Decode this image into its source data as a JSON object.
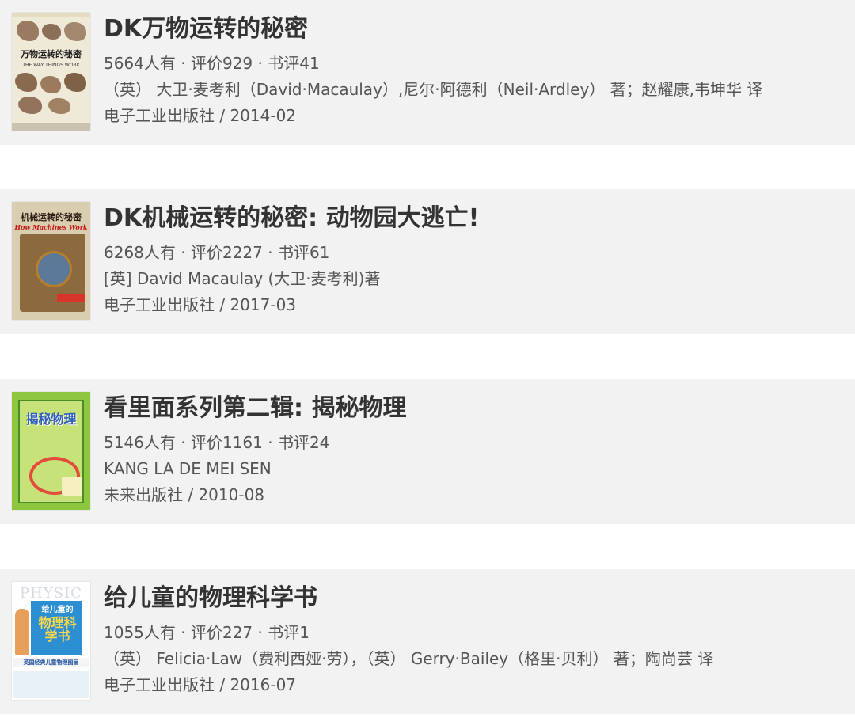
{
  "books": [
    {
      "title": "DK万物运转的秘密",
      "stats": "5664人有 · 评价929 · 书评41",
      "authors": "（英） 大卫·麦考利（David·Macaulay）,尼尔·阿德利（Neil·Ardley） 著；赵耀康,韦坤华 译",
      "publisher_date": "电子工业出版社 / 2014-02",
      "cover": {
        "title": "万物运转的秘密",
        "subtitle": "THE WAY THINGS WORK"
      }
    },
    {
      "title": "DK机械运转的秘密: 动物园大逃亡!",
      "stats": "6268人有 · 评价2227 · 书评61",
      "authors": "[英] David Macaulay (大卫·麦考利)著",
      "publisher_date": "电子工业出版社 / 2017-03",
      "cover": {
        "title": "机械运转的秘密",
        "subtitle": "How Machines Work"
      }
    },
    {
      "title": "看里面系列第二辑: 揭秘物理",
      "stats": "5146人有 · 评价1161 · 书评24",
      "authors": "KANG LA DE MEI SEN",
      "publisher_date": "未来出版社 / 2010-08",
      "cover": {
        "title": "揭秘物理"
      }
    },
    {
      "title": "给儿童的物理科学书",
      "stats": "1055人有 · 评价227 · 书评1",
      "authors": "（英） Felicia·Law（费利西娅·劳），（英） Gerry·Bailey（格里·贝利） 著；陶尚芸 译",
      "publisher_date": "电子工业出版社 / 2016-07",
      "cover": {
        "word": "PHYSIC",
        "title": "给儿童的",
        "big": "物理科学书",
        "banner": "英国经典儿童物理图画"
      }
    }
  ]
}
